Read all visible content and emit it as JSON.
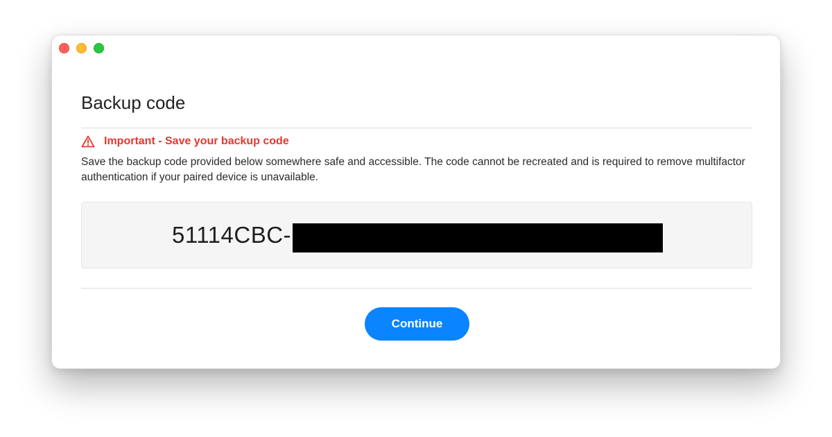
{
  "window": {
    "traffic_lights": [
      "close",
      "minimize",
      "zoom"
    ]
  },
  "dialog": {
    "title": "Backup code",
    "warning": {
      "icon": "warning-triangle-icon",
      "text": "Important - Save your backup code",
      "color": "#e5372f"
    },
    "description": "Save the backup code provided below somewhere safe and accessible. The code cannot be recreated and is required to remove multifactor authentication if your paired device is unavailable.",
    "code": {
      "visible_prefix": "51114CBC-",
      "redacted": true
    },
    "continue_label": "Continue",
    "accent_color": "#0a84ff"
  }
}
